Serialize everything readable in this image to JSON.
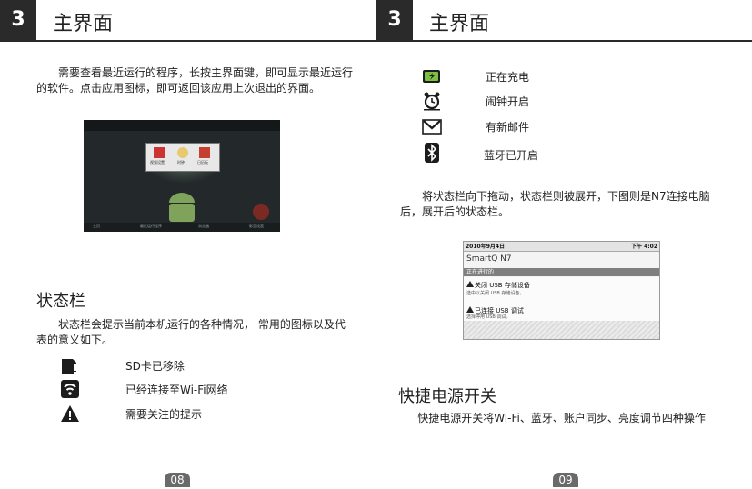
{
  "left": {
    "header": {
      "number": "3",
      "title": "主界面"
    },
    "intro": "需要查看最近运行的程序，长按主界面键，即可显示最近运行的软件。点击应用图标，即可返回该应用上次退出的界面。",
    "section_title": "状态栏",
    "section_text": "状态栏会提示当前本机运行的各种情况， 常用的图标以及代表的意义如下。",
    "legend": [
      {
        "icon": "sd-card-removed-icon",
        "label": "SD卡已移除"
      },
      {
        "icon": "wifi-connected-icon",
        "label": "已经连接至Wi-Fi网络"
      },
      {
        "icon": "warning-icon",
        "label": "需要关注的提示"
      }
    ],
    "home_screen": {
      "apps": [
        "视频设置",
        "时钟",
        "日历板"
      ],
      "dock": [
        "主页",
        "最近运行程序",
        "浏览器",
        "影音设置"
      ]
    },
    "page_number": "08"
  },
  "right": {
    "header": {
      "number": "3",
      "title": "主界面"
    },
    "legend": [
      {
        "icon": "battery-charging-icon",
        "label": "正在充电"
      },
      {
        "icon": "alarm-clock-icon",
        "label": "闹钟开启"
      },
      {
        "icon": "gmail-icon",
        "label": "有新邮件"
      },
      {
        "icon": "bluetooth-icon",
        "label": "蓝牙已开启"
      }
    ],
    "drag_text": "将状态栏向下拖动，状态栏则被展开，下图则是N7连接电脑后，展开后的状态栏。",
    "statusbar": {
      "date": "2010年9月4日",
      "time": "下午 4:02",
      "device_name": "SmartQ N7",
      "ongoing": "正在进行的",
      "items": [
        {
          "title": "关闭 USB 存储设备",
          "sub": "选中以关闭 USB 存储设备。"
        },
        {
          "title": "已连接 USB 调试",
          "sub": "选择停用 USB 调试。"
        }
      ]
    },
    "section_title": "快捷电源开关",
    "section_text": "快捷电源开关将Wi-Fi、蓝牙、账户同步、亮度调节四种操作",
    "page_number": "09"
  }
}
